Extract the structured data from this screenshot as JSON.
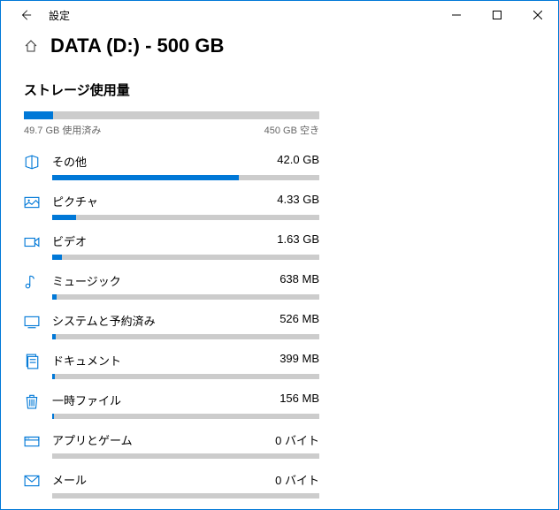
{
  "titlebar": {
    "title": "設定"
  },
  "header": {
    "page_title": "DATA (D:) - 500 GB"
  },
  "usage": {
    "section_title": "ストレージ使用量",
    "used_label": "49.7 GB 使用済み",
    "free_label": "450 GB 空き",
    "used_percent": 10
  },
  "categories": [
    {
      "label": "その他",
      "size": "42.0 GB",
      "percent": 70,
      "icon": "other"
    },
    {
      "label": "ピクチャ",
      "size": "4.33 GB",
      "percent": 9,
      "icon": "pictures"
    },
    {
      "label": "ビデオ",
      "size": "1.63 GB",
      "percent": 3.5,
      "icon": "videos"
    },
    {
      "label": "ミュージック",
      "size": "638 MB",
      "percent": 1.5,
      "icon": "music"
    },
    {
      "label": "システムと予約済み",
      "size": "526 MB",
      "percent": 1.2,
      "icon": "system"
    },
    {
      "label": "ドキュメント",
      "size": "399 MB",
      "percent": 1,
      "icon": "documents"
    },
    {
      "label": "一時ファイル",
      "size": "156 MB",
      "percent": 0.5,
      "icon": "temp"
    },
    {
      "label": "アプリとゲーム",
      "size": "0 バイト",
      "percent": 0,
      "icon": "apps"
    },
    {
      "label": "メール",
      "size": "0 バイト",
      "percent": 0,
      "icon": "mail"
    }
  ]
}
